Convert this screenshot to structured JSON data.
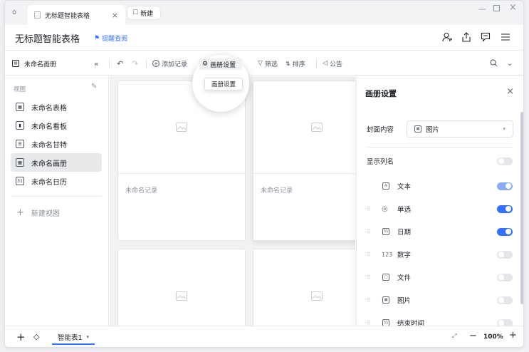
{
  "window": {
    "controls": [
      "minimize-icon",
      "maximize-icon",
      "close-icon"
    ]
  },
  "tabs": [
    {
      "label": "无标题智能表格",
      "icon": "table-icon"
    },
    {
      "label": "新建",
      "icon": "new-doc-icon"
    }
  ],
  "header": {
    "title": "无标题智能表格",
    "reminder": "提醒查阅",
    "icons": [
      "add-member-icon",
      "share-icon",
      "comment-icon",
      "menu-icon"
    ]
  },
  "toolbar": {
    "view_name": "未命名画册",
    "add_record": "添加记录",
    "gallery_settings": "画册设置",
    "filter": "筛选",
    "sort": "排序",
    "notice": "公告",
    "tooltip": "画册设置"
  },
  "sidebar": {
    "title": "视图",
    "items": [
      {
        "label": "未命名表格",
        "icon": "grid-view-icon"
      },
      {
        "label": "未命名看板",
        "icon": "kanban-view-icon"
      },
      {
        "label": "未命名甘特",
        "icon": "gantt-view-icon"
      },
      {
        "label": "未命名画册",
        "icon": "gallery-view-icon",
        "active": true
      },
      {
        "label": "未命名日历",
        "icon": "calendar-view-icon"
      }
    ],
    "new_view": "新建视图"
  },
  "gallery": {
    "cards": [
      {
        "label": "未命名记录"
      },
      {
        "label": "未命名记录"
      },
      {
        "label": ""
      },
      {
        "label": ""
      }
    ]
  },
  "panel": {
    "title": "画册设置",
    "cover_label": "封面内容",
    "cover_value": "图片",
    "show_column_label": "显示列名",
    "show_column_on": false,
    "fields": [
      {
        "icon": "A",
        "label": "文本",
        "on": true,
        "locked": true
      },
      {
        "icon": "◎",
        "label": "单选",
        "on": true
      },
      {
        "icon": "31",
        "label": "日期",
        "on": true
      },
      {
        "icon": "123",
        "label": "数字",
        "on": false
      },
      {
        "icon": "▢",
        "label": "文件",
        "on": false
      },
      {
        "icon": "▣",
        "label": "图片",
        "on": false
      },
      {
        "icon": "31",
        "label": "结束时间",
        "on": false
      }
    ]
  },
  "bottom": {
    "sheet": "智能表1",
    "zoom": "100%"
  },
  "colors": {
    "accent": "#3370ff",
    "active_bg": "#e8e9eb"
  }
}
